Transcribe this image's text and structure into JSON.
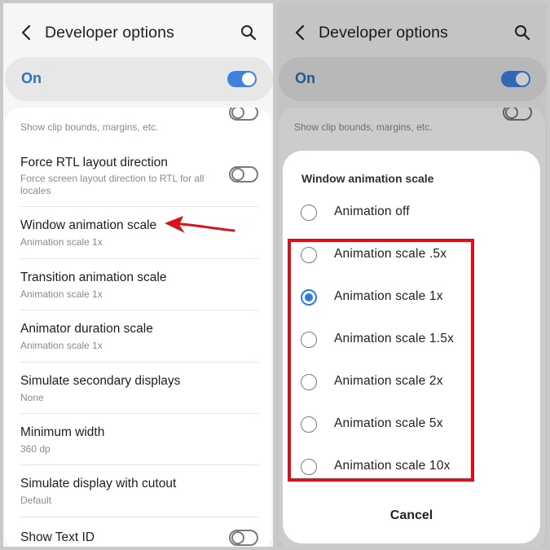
{
  "left": {
    "title": "Developer options",
    "master_label": "On",
    "master_on": true,
    "clip_bounds_sub": "Show clip bounds, margins, etc.",
    "rows": [
      {
        "title": "Force RTL layout direction",
        "sub": "Force screen layout direction to RTL for all locales",
        "toggle": "off"
      },
      {
        "title": "Window animation scale",
        "sub": "Animation scale 1x"
      },
      {
        "title": "Transition animation scale",
        "sub": "Animation scale 1x"
      },
      {
        "title": "Animator duration scale",
        "sub": "Animation scale 1x"
      },
      {
        "title": "Simulate secondary displays",
        "sub": "None"
      },
      {
        "title": "Minimum width",
        "sub": "360 dp"
      },
      {
        "title": "Simulate display with cutout",
        "sub": "Default"
      },
      {
        "title": "Show Text ID",
        "toggle": "off"
      }
    ]
  },
  "right": {
    "title": "Developer options",
    "master_label": "On",
    "clip_bounds_sub": "Show clip bounds, margins, etc.",
    "dialog": {
      "title": "Window animation scale",
      "options": [
        "Animation off",
        "Animation scale .5x",
        "Animation scale 1x",
        "Animation scale 1.5x",
        "Animation scale 2x",
        "Animation scale 5x",
        "Animation scale 10x"
      ],
      "selected": "Animation scale 1x",
      "cancel_label": "Cancel"
    }
  },
  "colors": {
    "accent": "#3e82e0",
    "annotation": "#d7121b"
  }
}
